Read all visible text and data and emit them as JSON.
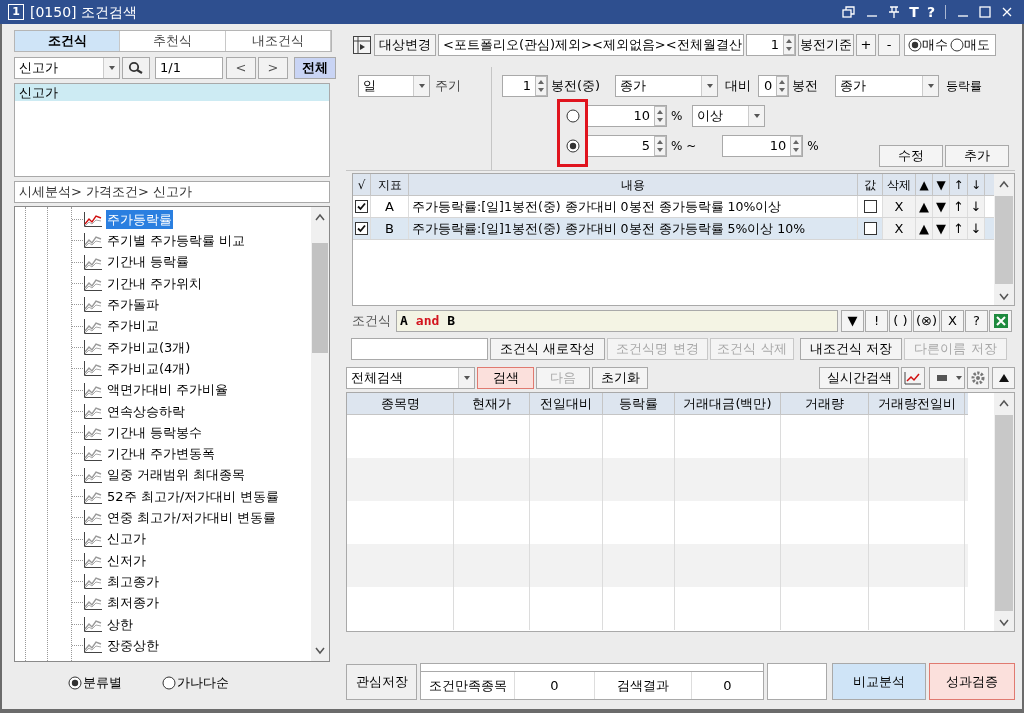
{
  "window": {
    "number": "1",
    "title": "[0150] 조건검색",
    "text_buttons": [
      "T",
      "?"
    ]
  },
  "left_tabs": [
    {
      "label": "조건식",
      "selected": true
    },
    {
      "label": "추천식",
      "selected": false
    },
    {
      "label": "내조건식",
      "selected": false
    }
  ],
  "condition_picker": {
    "value": "신고가",
    "page": "1/1",
    "prev": "<",
    "next": ">",
    "all_button": "전체"
  },
  "condition_list": [
    {
      "label": "신고가",
      "selected": true
    }
  ],
  "category_path": "시세분석> 가격조건> 신고가",
  "tree_items": [
    {
      "label": "주가등락률",
      "selected": true
    },
    {
      "label": "주기별 주가등락률 비교",
      "selected": false
    },
    {
      "label": "기간내 등락률",
      "selected": false
    },
    {
      "label": "기간내 주가위치",
      "selected": false
    },
    {
      "label": "주가돌파",
      "selected": false
    },
    {
      "label": "주가비교",
      "selected": false
    },
    {
      "label": "주가비교(3개)",
      "selected": false
    },
    {
      "label": "주가비교(4개)",
      "selected": false
    },
    {
      "label": "액면가대비 주가비율",
      "selected": false
    },
    {
      "label": "연속상승하락",
      "selected": false
    },
    {
      "label": "기간내 등락봉수",
      "selected": false
    },
    {
      "label": "기간내 주가변동폭",
      "selected": false
    },
    {
      "label": "일중 거래범위 최대종목",
      "selected": false
    },
    {
      "label": "52주 최고가/저가대비 변동률",
      "selected": false
    },
    {
      "label": "연중 최고가/저가대비 변동률",
      "selected": false
    },
    {
      "label": "신고가",
      "selected": false
    },
    {
      "label": "신저가",
      "selected": false
    },
    {
      "label": "최고종가",
      "selected": false
    },
    {
      "label": "최저종가",
      "selected": false
    },
    {
      "label": "상한",
      "selected": false
    },
    {
      "label": "장중상한",
      "selected": false
    }
  ],
  "sort_options": [
    {
      "label": "분류별",
      "selected": true
    },
    {
      "label": "가나다순",
      "selected": false
    }
  ],
  "target_bar": {
    "button": "대상변경",
    "target": "<포트폴리오(관심)제외><제외없음><전체월결산",
    "bars": "1",
    "basis_button": "봉전기준",
    "plus": "+",
    "minus": "-",
    "sides": [
      {
        "label": "매수",
        "selected": true
      },
      {
        "label": "매도",
        "selected": false
      }
    ]
  },
  "settings": {
    "period": "일",
    "period_label": "주기",
    "bars_from": "1",
    "bars_from_label": "봉전(중)",
    "price_from": "종가",
    "vs_label": "대비",
    "bars_to": "0",
    "bars_to_label": "봉전",
    "price_to": "종가",
    "metric_label": "등락률",
    "modes": [
      {
        "kind": "threshold",
        "selected": false,
        "value": "10",
        "unit": "%",
        "comparison": "이상"
      },
      {
        "kind": "range",
        "selected": true,
        "value": "5",
        "unit": "% ~",
        "max": "10",
        "max_unit": "%"
      }
    ],
    "buttons": [
      "수정",
      "추가"
    ]
  },
  "indicator_table": {
    "columns": [
      "√",
      "지표",
      "내용",
      "값",
      "삭제",
      "▲",
      "▼",
      "↑",
      "↓"
    ],
    "rows": [
      {
        "checked": true,
        "id": "A",
        "content": "주가등락률:[일]1봉전(중) 종가대비 0봉전 종가등락률 10%이상",
        "value_checked": false,
        "delete": "X",
        "up": "▲",
        "down": "▼",
        "top": "↑",
        "bottom": "↓",
        "selected": false
      },
      {
        "checked": true,
        "id": "B",
        "content": "주가등락률:[일]1봉전(중) 종가대비 0봉전 종가등락률 5%이상 10%",
        "value_checked": false,
        "delete": "X",
        "up": "▲",
        "down": "▼",
        "top": "↑",
        "bottom": "↓",
        "selected": true
      }
    ]
  },
  "formula": {
    "label": "조건식",
    "tokens": [
      {
        "text": "A",
        "kind": "operand"
      },
      {
        "text": "and",
        "kind": "operator"
      },
      {
        "text": "B",
        "kind": "operand"
      }
    ],
    "buttons": [
      "▼",
      "!",
      "( )",
      "(⊗)",
      "X",
      "?"
    ]
  },
  "name_row": {
    "buttons": [
      {
        "label": "조건식 새로작성",
        "disabled": false
      },
      {
        "label": "조건식명 변경",
        "disabled": true
      },
      {
        "label": "조건식 삭제",
        "disabled": true
      },
      {
        "label": "내조건식 저장",
        "disabled": false
      },
      {
        "label": "다른이름 저장",
        "disabled": true
      }
    ]
  },
  "search_row": {
    "scope": "전체검색",
    "buttons": [
      {
        "label": "검색",
        "highlighted": true,
        "disabled": false
      },
      {
        "label": "다음",
        "highlighted": false,
        "disabled": true
      },
      {
        "label": "초기화",
        "highlighted": false,
        "disabled": false
      }
    ],
    "realtime_button": "실시간검색"
  },
  "results_table": {
    "columns": [
      "종목명",
      "현재가",
      "전일대비",
      "등락률",
      "거래대금(백만)",
      "거래량",
      "거래량전일비"
    ]
  },
  "footer": {
    "save_button": "관심저장",
    "satisfied_label": "조건만족종목",
    "satisfied_count": "0",
    "result_label": "검색결과",
    "result_count": "0",
    "compare_button": "비교분석",
    "verify_button": "성과검증"
  }
}
